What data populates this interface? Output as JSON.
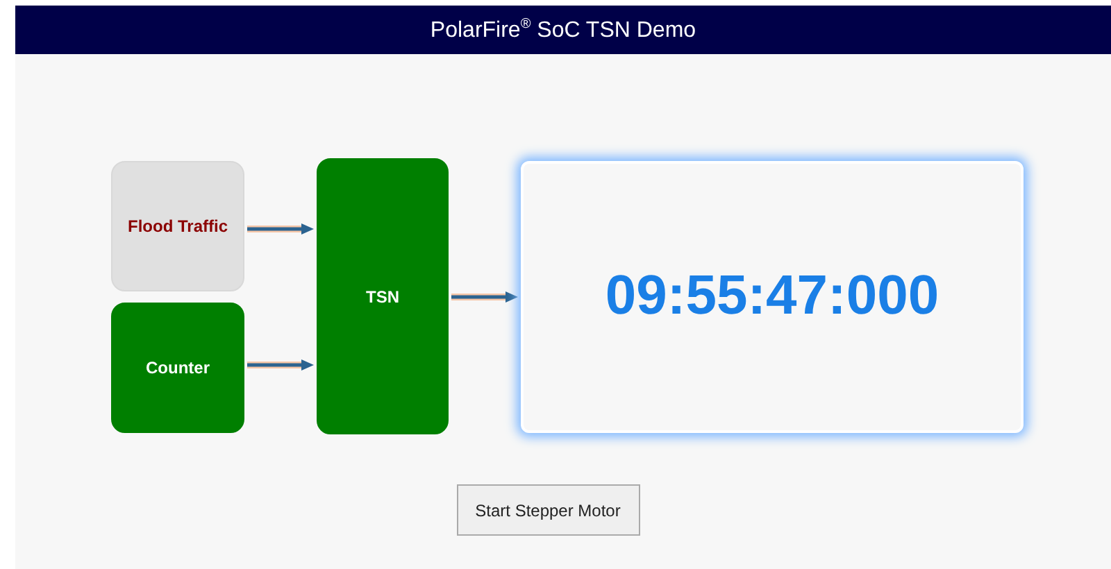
{
  "header": {
    "title": "PolarFire$^{®}$ SoC TSN Demo"
  },
  "sources": [
    {
      "label": "Flood Traffic",
      "active": false
    },
    {
      "label": "Counter",
      "active": true
    }
  ],
  "switch": {
    "label": "TSN",
    "active": true
  },
  "display": {
    "time": "09:55:47:000"
  },
  "button": {
    "label": "Start Stepper Motor"
  }
}
